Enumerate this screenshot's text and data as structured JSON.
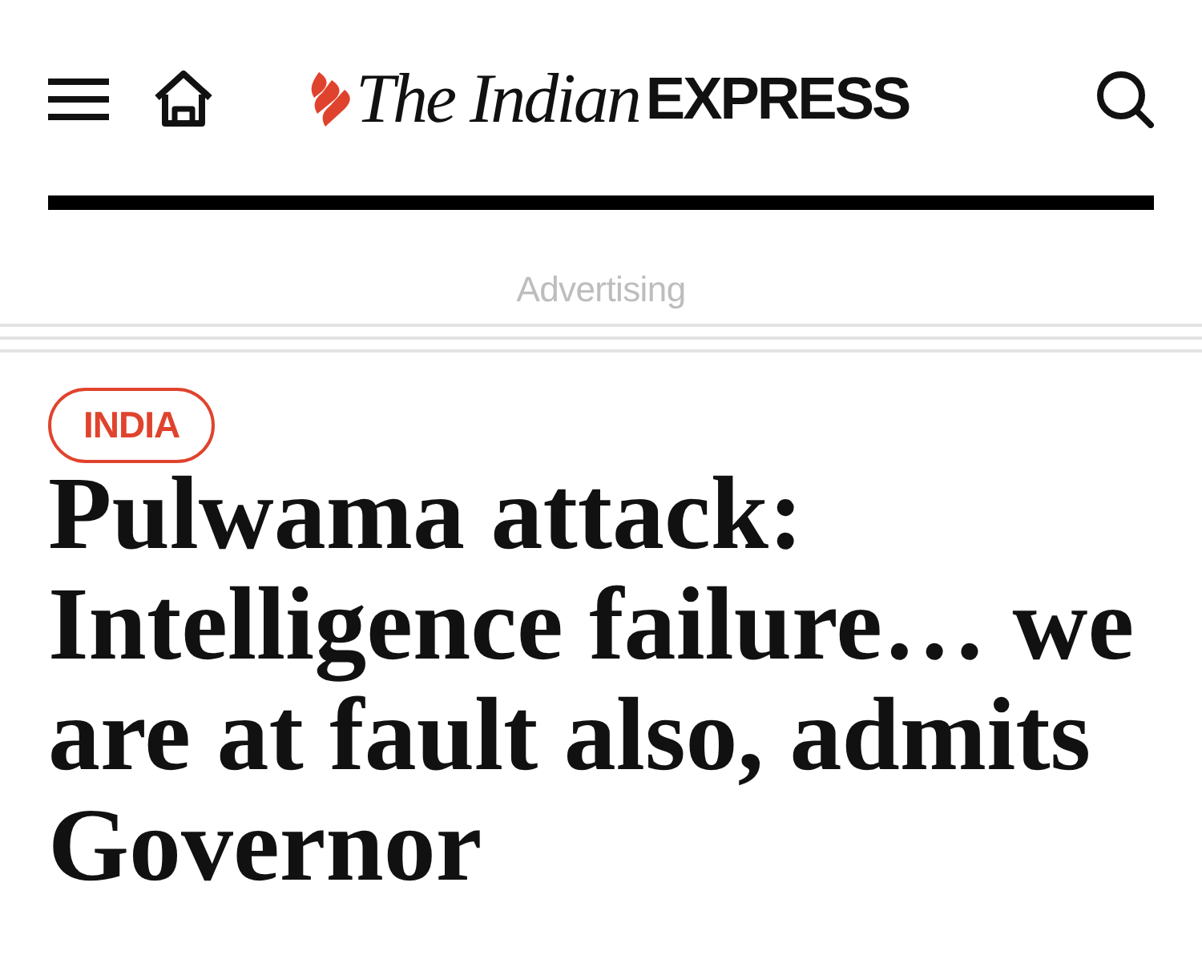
{
  "header": {
    "logo": {
      "serif_part": "The Indian",
      "sans_part": "EXPRESS"
    }
  },
  "ad_label": "Advertising",
  "article": {
    "category": "INDIA",
    "headline": "Pulwama attack: Intelligence failure… we are at fault also, admits Governor"
  }
}
